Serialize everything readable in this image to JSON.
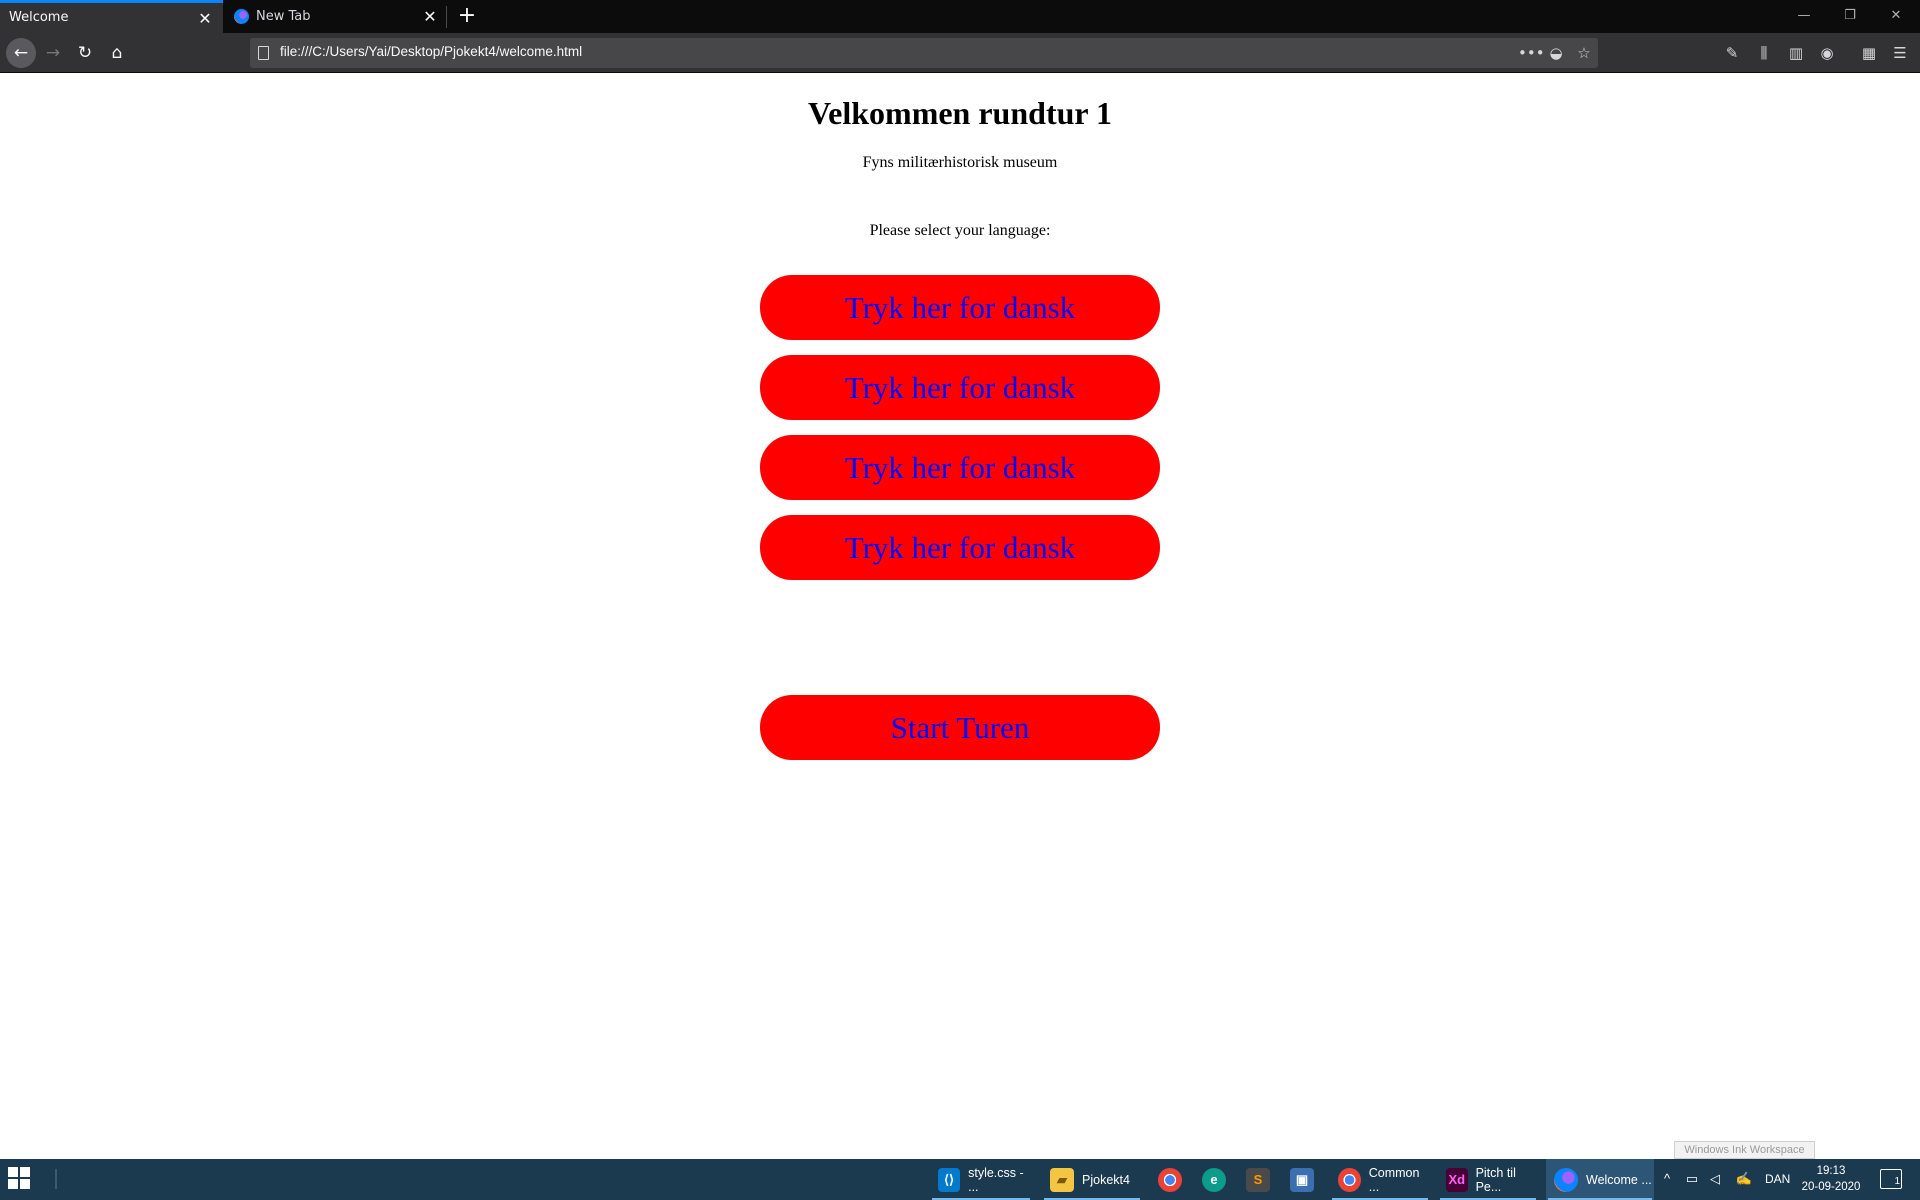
{
  "browser": {
    "tabs": [
      {
        "title": "Welcome",
        "active": true
      },
      {
        "title": "New Tab",
        "active": false
      }
    ],
    "url": "file:///C:/Users/Yai/Desktop/Pjokekt4/welcome.html",
    "accent_color": "#0a84ff"
  },
  "page": {
    "title": "Velkommen rundtur 1",
    "subtitle": "Fyns militærhistorisk museum",
    "prompt": "Please select your language:",
    "language_buttons": [
      {
        "label": "Tryk her for dansk"
      },
      {
        "label": "Tryk her for dansk"
      },
      {
        "label": "Tryk her for dansk"
      },
      {
        "label": "Tryk her for dansk"
      }
    ],
    "start_button": {
      "label": "Start Turen"
    },
    "button_color": "#ff0000",
    "button_text_color": "#0000ff"
  },
  "tooltip": {
    "text": "Windows Ink Workspace"
  },
  "taskbar": {
    "items": [
      {
        "label": "style.css - ...",
        "icon": "vscode-icon"
      },
      {
        "label": "Pjokekt4",
        "icon": "folder-icon"
      },
      {
        "label": "",
        "icon": "chrome-icon"
      },
      {
        "label": "",
        "icon": "edge-icon"
      },
      {
        "label": "",
        "icon": "sublime-icon"
      },
      {
        "label": "",
        "icon": "app-icon"
      },
      {
        "label": "Common ...",
        "icon": "chrome-icon"
      },
      {
        "label": "Pitch til Pe...",
        "icon": "adobe-xd-icon"
      },
      {
        "label": "Welcome ...",
        "icon": "firefox-icon"
      }
    ],
    "tray": {
      "language": "DAN",
      "time": "19:13",
      "date": "20-09-2020",
      "notification_count": "1"
    }
  }
}
